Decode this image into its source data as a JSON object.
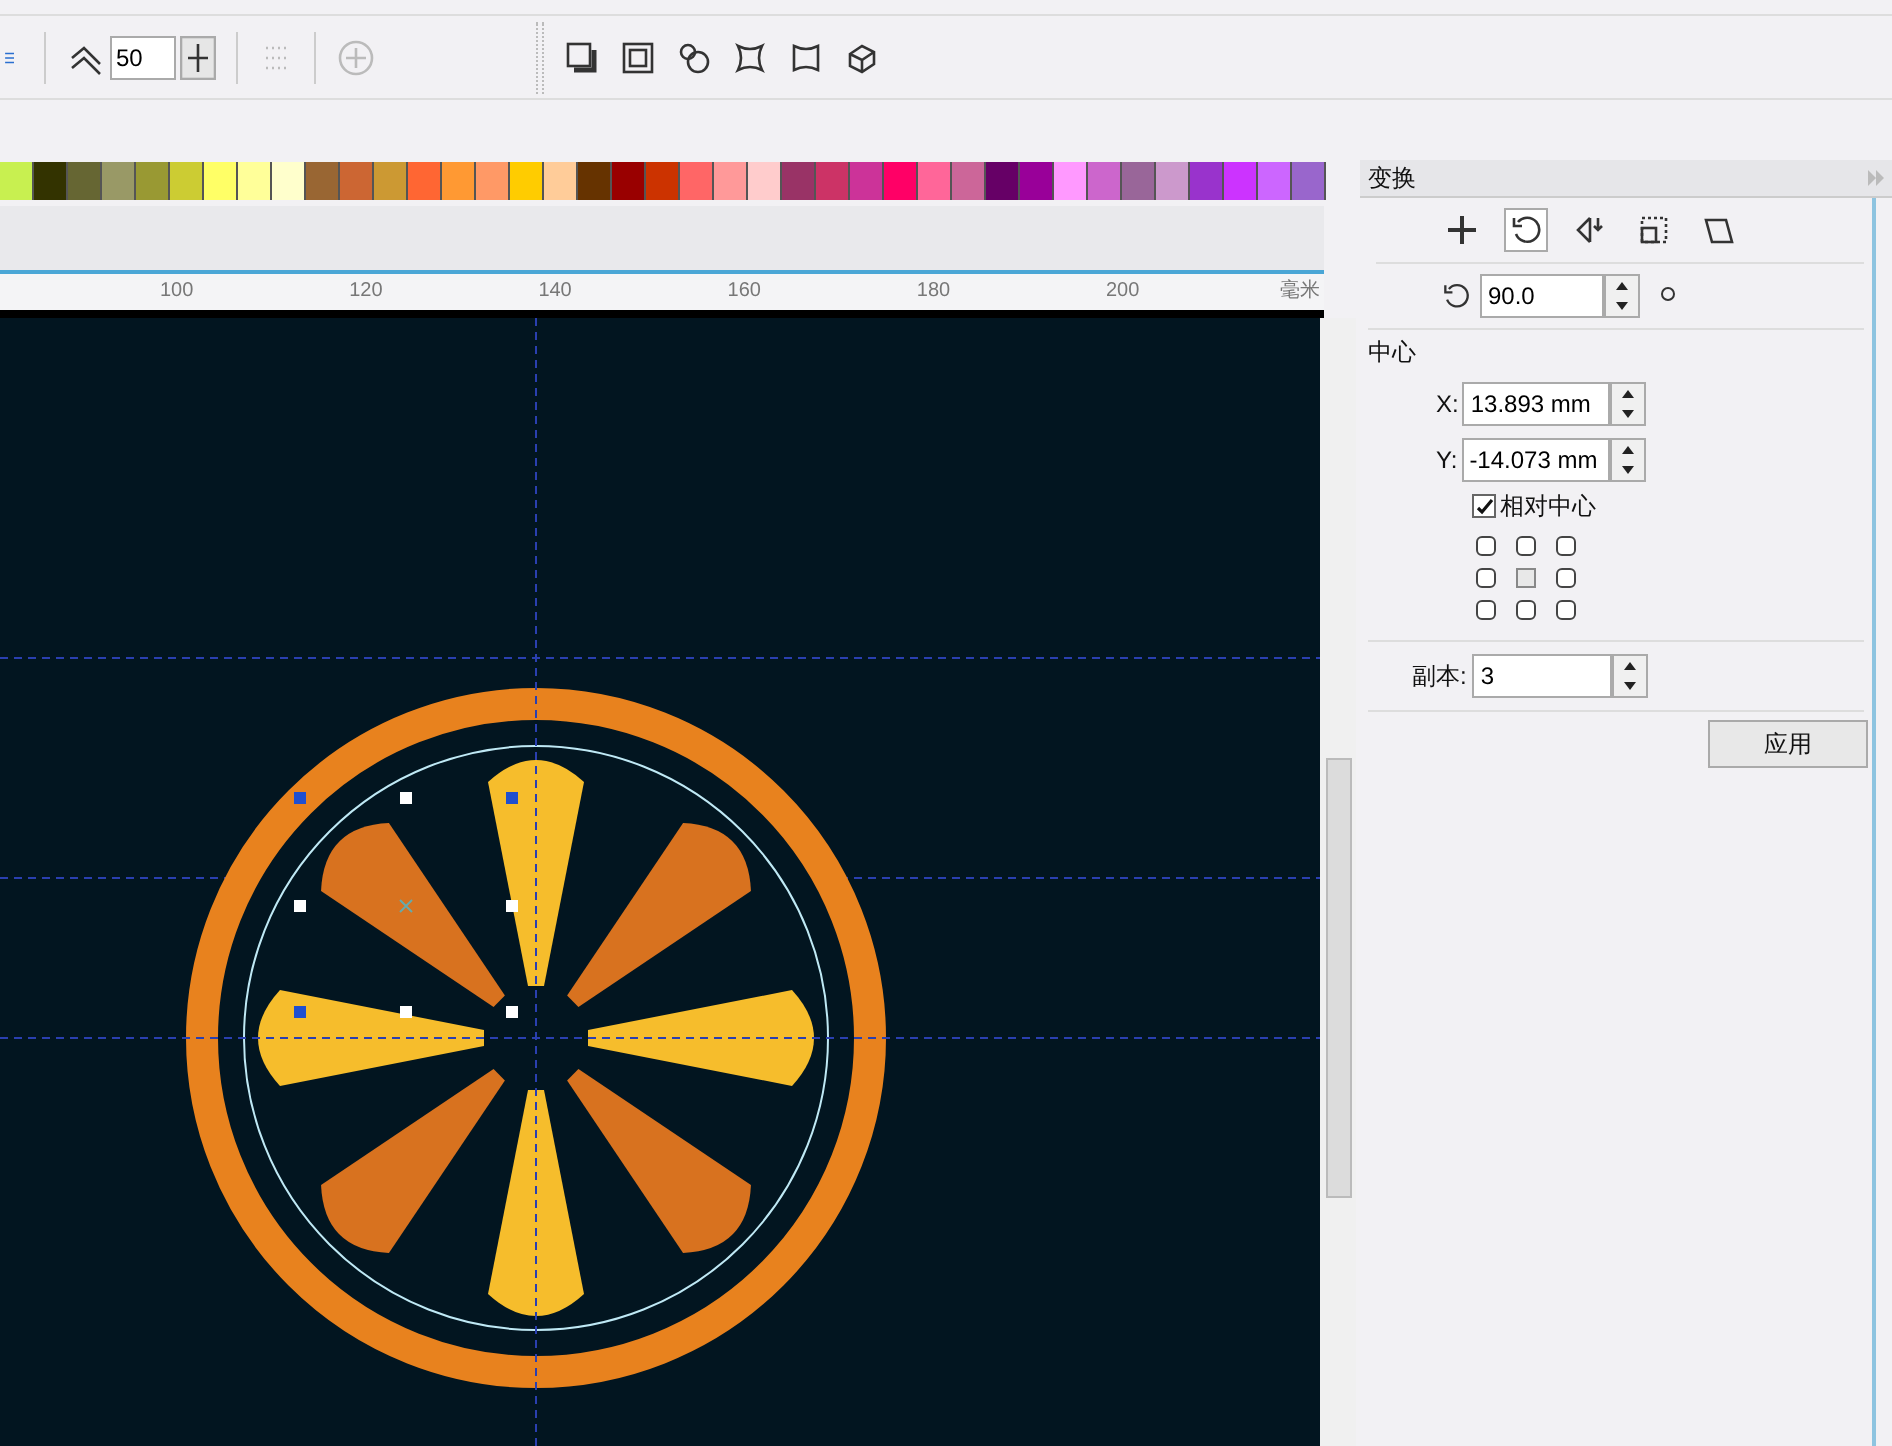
{
  "toolbar": {
    "smoothness_value": "50"
  },
  "palette": [
    {
      "color": "#c8f050"
    },
    {
      "color": "#333300"
    },
    {
      "color": "#666633"
    },
    {
      "color": "#999966"
    },
    {
      "color": "#999933"
    },
    {
      "color": "#cccc33"
    },
    {
      "color": "#ffff66"
    },
    {
      "color": "#ffff99"
    },
    {
      "color": "#ffffcc"
    },
    {
      "color": "#996633"
    },
    {
      "color": "#cc6633"
    },
    {
      "color": "#cc9933"
    },
    {
      "color": "#ff6633"
    },
    {
      "color": "#ff9933"
    },
    {
      "color": "#ff9966"
    },
    {
      "color": "#ffcc00"
    },
    {
      "color": "#ffcc99"
    },
    {
      "color": "#663300"
    },
    {
      "color": "#990000"
    },
    {
      "color": "#cc3300"
    },
    {
      "color": "#ff6666"
    },
    {
      "color": "#ff9999"
    },
    {
      "color": "#ffcccc"
    },
    {
      "color": "#993366"
    },
    {
      "color": "#cc3366"
    },
    {
      "color": "#cc3399"
    },
    {
      "color": "#ff0066"
    },
    {
      "color": "#ff6699"
    },
    {
      "color": "#cc6699"
    },
    {
      "color": "#660066"
    },
    {
      "color": "#990099"
    },
    {
      "color": "#ff99ff"
    },
    {
      "color": "#cc66cc"
    },
    {
      "color": "#996699"
    },
    {
      "color": "#cc99cc"
    },
    {
      "color": "#9933cc"
    },
    {
      "color": "#cc33ff"
    },
    {
      "color": "#cc66ff"
    },
    {
      "color": "#9966cc"
    }
  ],
  "ruler": {
    "labels": [
      "100",
      "120",
      "140",
      "160",
      "180",
      "200"
    ],
    "unit": "毫米"
  },
  "panel": {
    "title": "变换",
    "tabs": [
      {
        "kind": "position",
        "selected": false
      },
      {
        "kind": "rotate",
        "selected": true
      },
      {
        "kind": "scale",
        "selected": false
      },
      {
        "kind": "size",
        "selected": false
      },
      {
        "kind": "skew",
        "selected": false
      }
    ],
    "angle": "90.0",
    "center_label": "中心",
    "x_label": "X:",
    "x_value": "13.893 mm",
    "y_label": "Y:",
    "y_value": "-14.073 mm",
    "relative_center": {
      "label": "相对中心",
      "checked": true
    },
    "anchors": [
      {
        "selected": false
      },
      {
        "selected": false
      },
      {
        "selected": false
      },
      {
        "selected": false
      },
      {
        "selected": true
      },
      {
        "selected": false
      },
      {
        "selected": false
      },
      {
        "selected": false
      },
      {
        "selected": false
      }
    ],
    "copies_label": "副本:",
    "copies_value": "3",
    "apply_button": "应用"
  }
}
